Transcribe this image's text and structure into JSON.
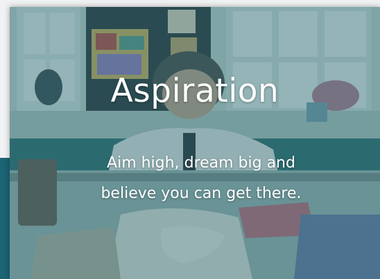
{
  "card": {
    "title": "Aspiration",
    "subtitle_line1": "Aim high, dream big and",
    "subtitle_line2": "believe you can get there."
  },
  "colors": {
    "accent": "#1b6474",
    "overlay": "#286970",
    "text": "#ffffff"
  }
}
